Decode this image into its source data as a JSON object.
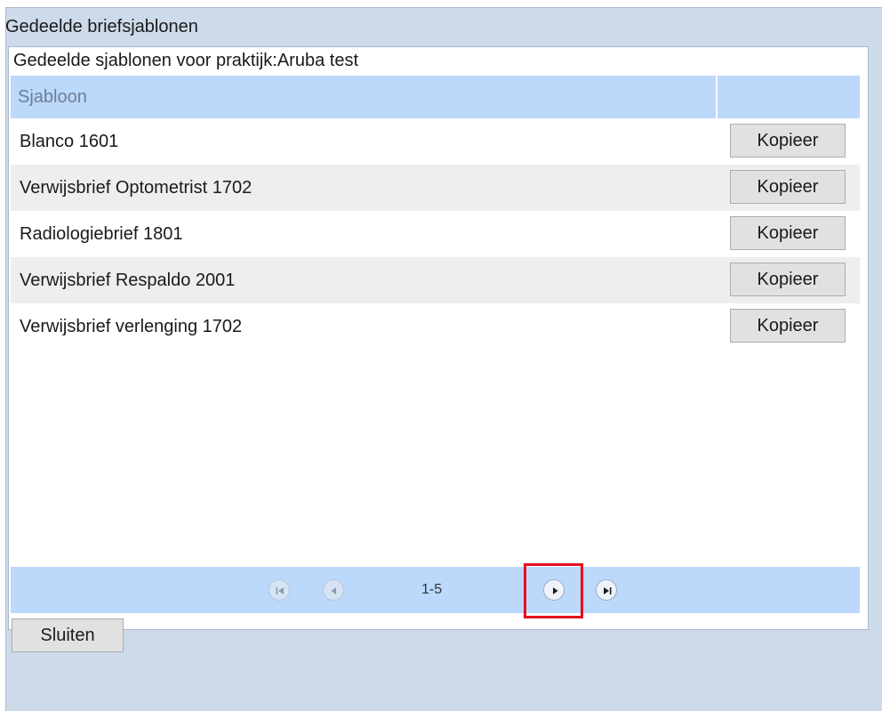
{
  "window": {
    "title": "Gedeelde briefsjablonen"
  },
  "panel": {
    "subtitle": "Gedeelde sjablonen voor praktijk:Aruba test"
  },
  "grid": {
    "header": {
      "name_col": "Sjabloon",
      "action_col": ""
    },
    "rows": [
      {
        "name": "Blanco 1601",
        "action": "Kopieer"
      },
      {
        "name": "Verwijsbrief Optometrist 1702",
        "action": "Kopieer"
      },
      {
        "name": "Radiologiebrief 1801",
        "action": "Kopieer"
      },
      {
        "name": "Verwijsbrief Respaldo 2001",
        "action": "Kopieer"
      },
      {
        "name": "Verwijsbrief verlenging 1702",
        "action": "Kopieer"
      }
    ]
  },
  "pager": {
    "range_text": "1-5",
    "first": {
      "icon": "first-page-icon",
      "enabled": false
    },
    "prev": {
      "icon": "prev-page-icon",
      "enabled": false
    },
    "next": {
      "icon": "next-page-icon",
      "enabled": true
    },
    "last": {
      "icon": "last-page-icon",
      "enabled": true
    },
    "highlight_color": "#e3101d"
  },
  "footer": {
    "close_label": "Sluiten"
  },
  "colors": {
    "header_bg": "#bcd8fb",
    "window_bg": "#cddaea",
    "alt_row_bg": "#eeeeee"
  }
}
